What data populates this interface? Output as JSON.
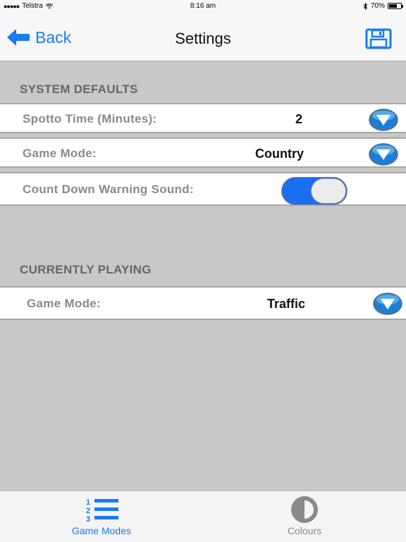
{
  "status_bar": {
    "carrier": "Telstra",
    "signal_dots": "●●●●●",
    "time": "8:16 am",
    "battery_percent": "70%",
    "battery_level": 0.7
  },
  "nav": {
    "back_label": "Back",
    "title": "Settings",
    "save_icon": "floppy-disk-icon"
  },
  "system_defaults": {
    "header": "SYSTEM DEFAULTS",
    "spotto_time_label": "Spotto Time (Minutes):",
    "spotto_time_value": "2",
    "game_mode_label": "Game Mode:",
    "game_mode_value": "Country",
    "count_down_label": "Count Down Warning Sound:",
    "count_down_enabled": true
  },
  "currently_playing": {
    "header": "CURRENTLY PLAYING",
    "game_mode_label": "Game Mode:",
    "game_mode_value": "Traffic"
  },
  "tabs": [
    {
      "label": "Game Modes",
      "icon": "numbered-list-icon",
      "selected": true
    },
    {
      "label": "Colours",
      "icon": "half-circle-icon",
      "selected": false
    }
  ],
  "colors": {
    "accent": "#1a7bf2",
    "background": "#c8c8c8"
  }
}
